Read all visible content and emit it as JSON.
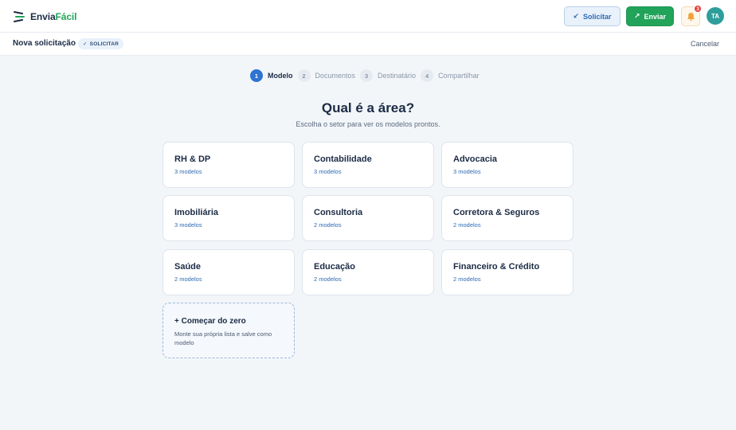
{
  "app": {
    "brand_part1": "Envia",
    "brand_part2": "Fácil"
  },
  "header": {
    "solicitar_label": "Solicitar",
    "enviar_label": "Enviar",
    "notifications_count": "3",
    "avatar_initials": "TA"
  },
  "subbar": {
    "title": "Nova solicitação",
    "tag": "SOLICITAR",
    "cancel_label": "Cancelar"
  },
  "steps": [
    {
      "num": "1",
      "label": "Modelo",
      "active": true
    },
    {
      "num": "2",
      "label": "Documentos",
      "active": false
    },
    {
      "num": "3",
      "label": "Destinatário",
      "active": false
    },
    {
      "num": "4",
      "label": "Compartilhar",
      "active": false
    }
  ],
  "main": {
    "title": "Qual é a área?",
    "subtitle": "Escolha o setor para ver os modelos prontos.",
    "areas": [
      {
        "title": "RH & DP",
        "count": "3 modelos"
      },
      {
        "title": "Contabilidade",
        "count": "3 modelos"
      },
      {
        "title": "Advocacia",
        "count": "3 modelos"
      },
      {
        "title": "Imobiliária",
        "count": "3 modelos"
      },
      {
        "title": "Consultoria",
        "count": "2 modelos"
      },
      {
        "title": "Corretora & Seguros",
        "count": "2 modelos"
      },
      {
        "title": "Saúde",
        "count": "2 modelos"
      },
      {
        "title": "Educação",
        "count": "2 modelos"
      },
      {
        "title": "Financeiro & Crédito",
        "count": "2 modelos"
      }
    ],
    "new_card": {
      "title": "+ Começar do zero",
      "description": "Monte sua própria lista e salve como modelo"
    }
  },
  "colors": {
    "accent_blue": "#2e74d1",
    "brand_green": "#21a35a",
    "badge_red": "#e53d3d",
    "avatar_teal": "#2e9e9a"
  },
  "icons": {
    "logo": "envia-facil-logo-icon",
    "solicitar": "arrow-down-left-icon",
    "enviar": "arrow-up-right-icon",
    "notifications": "bell-icon",
    "tag": "check-icon"
  }
}
